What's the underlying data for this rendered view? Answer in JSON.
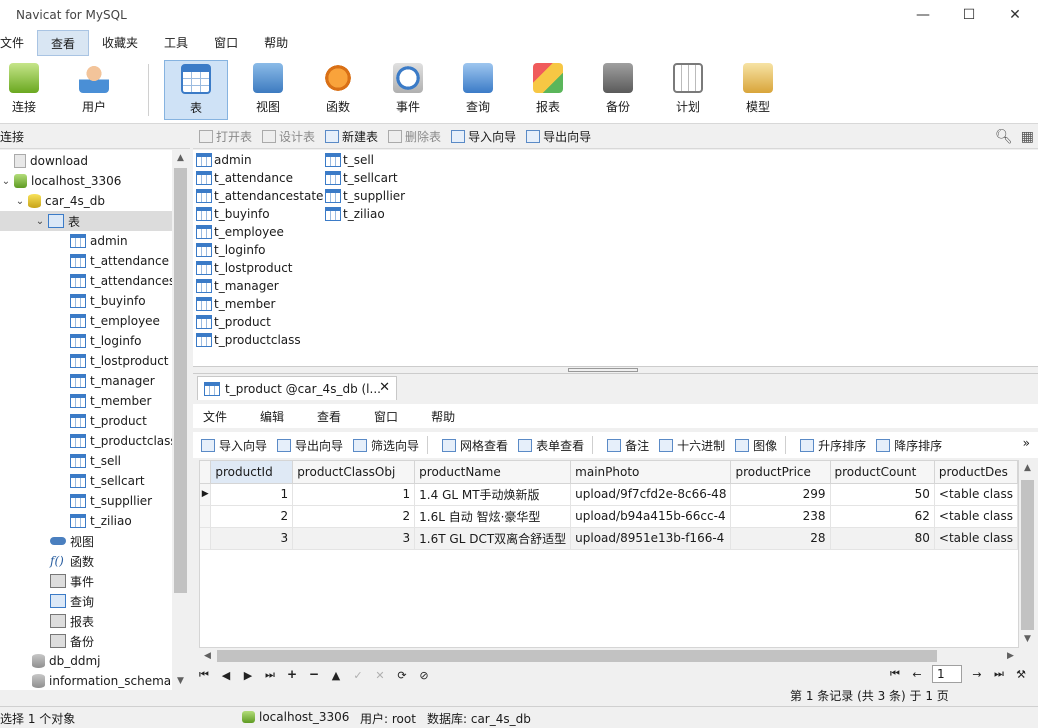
{
  "window": {
    "title": "Navicat for MySQL",
    "controls": {
      "minimize": "—",
      "maximize": "☐",
      "close": "✕"
    }
  },
  "menubar": [
    "文件",
    "查看",
    "收藏夹",
    "工具",
    "窗口",
    "帮助"
  ],
  "ribbon": {
    "connect": "连接",
    "user": "用户",
    "tools": [
      {
        "label": "表",
        "icon": "table-icon",
        "active": true
      },
      {
        "label": "视图",
        "icon": "view-icon"
      },
      {
        "label": "函数",
        "icon": "function-icon"
      },
      {
        "label": "事件",
        "icon": "event-icon"
      },
      {
        "label": "查询",
        "icon": "query-icon"
      },
      {
        "label": "报表",
        "icon": "report-icon"
      },
      {
        "label": "备份",
        "icon": "backup-icon"
      },
      {
        "label": "计划",
        "icon": "schedule-icon"
      },
      {
        "label": "模型",
        "icon": "model-icon"
      }
    ]
  },
  "connection_panel": {
    "header": "连接"
  },
  "subtoolbar": {
    "open_table": "打开表",
    "design_table": "设计表",
    "new_table": "新建表",
    "delete_table": "删除表",
    "import_wizard": "导入向导",
    "export_wizard": "导出向导"
  },
  "tree": {
    "download": "download",
    "connection": "localhost_3306",
    "database": "car_4s_db",
    "tables_folder": "表",
    "tables": [
      "admin",
      "t_attendance",
      "t_attendancestate",
      "t_buyinfo",
      "t_employee",
      "t_loginfo",
      "t_lostproduct",
      "t_manager",
      "t_member",
      "t_product",
      "t_productclass",
      "t_sell",
      "t_sellcart",
      "t_suppllier",
      "t_ziliao"
    ],
    "views": "视图",
    "functions": "函数",
    "events": "事件",
    "queries": "查询",
    "reports": "报表",
    "backups": "备份",
    "other_dbs": [
      "db_ddmj",
      "information_schema"
    ]
  },
  "objects": {
    "col1": [
      "admin",
      "t_attendance",
      "t_attendancestate",
      "t_buyinfo",
      "t_employee",
      "t_loginfo",
      "t_lostproduct",
      "t_manager",
      "t_member",
      "t_product",
      "t_productclass"
    ],
    "col2": [
      "t_sell",
      "t_sellcart",
      "t_suppllier",
      "t_ziliao"
    ]
  },
  "doc_tab": {
    "label": "t_product @car_4s_db (l...",
    "close": "✕"
  },
  "doc_menu": [
    "文件",
    "编辑",
    "查看",
    "窗口",
    "帮助"
  ],
  "doc_toolbar": {
    "import_wizard": "导入向导",
    "export_wizard": "导出向导",
    "filter_wizard": "筛选向导",
    "grid_view": "网格查看",
    "form_view": "表单查看",
    "memo": "备注",
    "hex": "十六进制",
    "image": "图像",
    "sort_asc": "升序排序",
    "sort_desc": "降序排序",
    "more": "»"
  },
  "grid": {
    "columns": [
      "productId",
      "productClassObj",
      "productName",
      "mainPhoto",
      "productPrice",
      "productCount",
      "productDes"
    ],
    "rows": [
      [
        "1",
        "1",
        "1.4 GL MT手动焕新版",
        "upload/9f7cfd2e-8c66-48",
        "299",
        "50",
        "<table class"
      ],
      [
        "2",
        "2",
        "1.6L 自动 智炫·豪华型",
        "upload/b94a415b-66cc-4",
        "238",
        "62",
        "<table class"
      ],
      [
        "3",
        "3",
        "1.6T GL DCT双离合舒适型",
        "upload/8951e13b-f166-4",
        "28",
        "80",
        "<table class"
      ]
    ]
  },
  "page_nav": {
    "current_page": "1"
  },
  "record_status": "第 1 条记录 (共 3 条) 于 1 页",
  "statusbar": {
    "selection": "选择 1 个对象",
    "connection": "localhost_3306",
    "user": "用户: root",
    "database": "数据库: car_4s_db"
  }
}
